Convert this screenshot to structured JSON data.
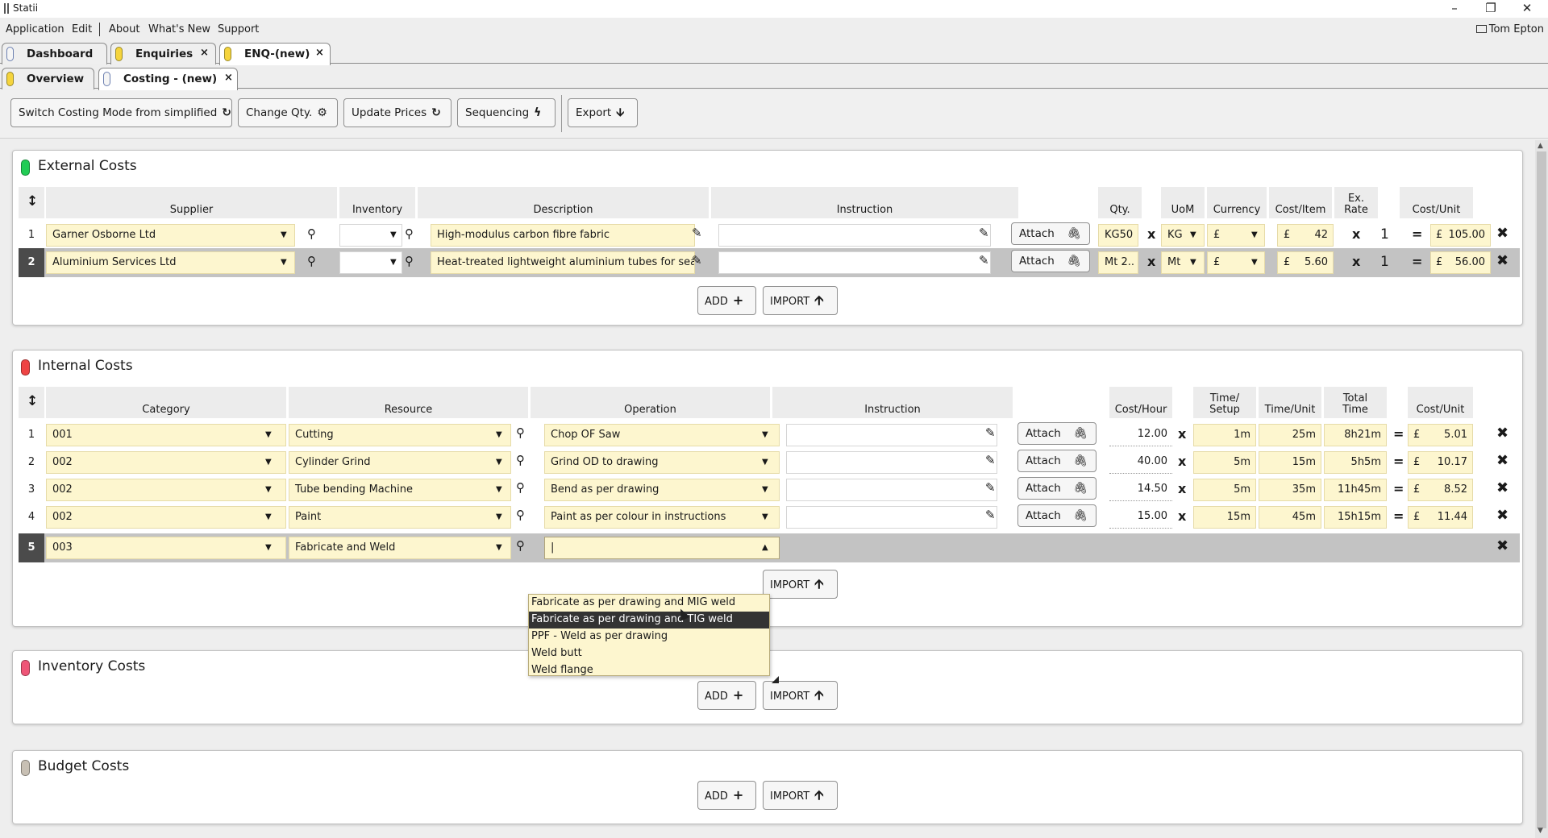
{
  "window": {
    "title": "Statii",
    "minimize": "–",
    "restore": "❐",
    "close": "✕"
  },
  "menu": {
    "items": [
      "Application",
      "Edit",
      "About",
      "What's New",
      "Support"
    ],
    "user": "Tom Epton"
  },
  "tabs_top": [
    {
      "label": "Dashboard"
    },
    {
      "label": "Enquiries",
      "close": "×"
    },
    {
      "label": "ENQ-(new)",
      "close": "×"
    }
  ],
  "tabs_sub": [
    {
      "label": "Overview"
    },
    {
      "label": "Costing - (new)",
      "close": "×"
    }
  ],
  "toolbar": {
    "switch_mode": "Switch Costing Mode from simplified",
    "change_qty": "Change Qty.",
    "update_prices": "Update Prices",
    "sequencing": "Sequencing",
    "export": "Export"
  },
  "icons": {
    "refresh": "↻",
    "gear": "⚙",
    "bolt": "ϟ",
    "down": "🡫",
    "up": "🡩",
    "plus": "+",
    "search": "⚲",
    "pencil": "✎",
    "paperclip": "🖇",
    "caret_down": "▼",
    "caret_up": "▲",
    "delete": "✖",
    "sort": "↕"
  },
  "colors": {
    "external": "#22cc55",
    "internal": "#ee4444",
    "inventory": "#ee5577",
    "budget": "#c8c0b4",
    "field_yellow": "#fdf6cf",
    "selected_row": "#333333"
  },
  "external": {
    "title": "External Costs",
    "headers": {
      "supplier": "Supplier",
      "inventory": "Inventory",
      "description": "Description",
      "instruction": "Instruction",
      "qty": "Qty.",
      "uom": "UoM",
      "currency": "Currency",
      "cost_item": "Cost/Item",
      "ex_rate_1": "Ex.",
      "ex_rate_2": "Rate",
      "cost_unit": "Cost/Unit"
    },
    "rows": [
      {
        "num": "1",
        "supplier": "Garner Osborne Ltd",
        "inventory": "",
        "description": "High-modulus carbon fibre fabric",
        "instruction": "",
        "attach": "Attach",
        "qty": "KG50",
        "x": "x",
        "uom": "KG",
        "currency": "£",
        "cost_currency": "£",
        "cost_item": "42",
        "ex_rate": "1",
        "eq": "=",
        "unit_currency": "£",
        "cost_unit": "105.00"
      },
      {
        "num": "2",
        "supplier": "Aluminium Services Ltd",
        "inventory": "",
        "description": "Heat-treated lightweight aluminium tubes for sea",
        "instruction": "",
        "attach": "Attach",
        "qty": "Mt 2..",
        "x": "x",
        "uom": "Mt",
        "currency": "£",
        "cost_currency": "£",
        "cost_item": "5.60",
        "ex_rate": "1",
        "eq": "=",
        "unit_currency": "£",
        "cost_unit": "56.00"
      }
    ],
    "add": "ADD",
    "import": "IMPORT"
  },
  "internal": {
    "title": "Internal Costs",
    "headers": {
      "category": "Category",
      "resource": "Resource",
      "operation": "Operation",
      "instruction": "Instruction",
      "cost_hour": "Cost/Hour",
      "time_setup_1": "Time/",
      "time_setup_2": "Setup",
      "time_unit": "Time/Unit",
      "total_time_1": "Total",
      "total_time_2": "Time",
      "cost_unit": "Cost/Unit"
    },
    "rows": [
      {
        "num": "1",
        "category": "001",
        "resource": "Cutting",
        "operation": "Chop OF Saw",
        "attach": "Attach",
        "cost_hour": "12.00",
        "x": "x",
        "setup": "1m",
        "time_unit": "25m",
        "total": "8h21m",
        "eq": "=",
        "currency": "£",
        "cost_unit": "5.01"
      },
      {
        "num": "2",
        "category": "002",
        "resource": "Cylinder Grind",
        "operation": "Grind OD to drawing",
        "attach": "Attach",
        "cost_hour": "40.00",
        "x": "x",
        "setup": "5m",
        "time_unit": "15m",
        "total": "5h5m",
        "eq": "=",
        "currency": "£",
        "cost_unit": "10.17"
      },
      {
        "num": "3",
        "category": "002",
        "resource": "Tube bending Machine",
        "operation": "Bend as per drawing",
        "attach": "Attach",
        "cost_hour": "14.50",
        "x": "x",
        "setup": "5m",
        "time_unit": "35m",
        "total": "11h45m",
        "eq": "=",
        "currency": "£",
        "cost_unit": "8.52"
      },
      {
        "num": "4",
        "category": "002",
        "resource": "Paint",
        "operation": "Paint as per colour in instructions",
        "attach": "Attach",
        "cost_hour": "15.00",
        "x": "x",
        "setup": "15m",
        "time_unit": "45m",
        "total": "15h15m",
        "eq": "=",
        "currency": "£",
        "cost_unit": "11.44"
      }
    ],
    "editing_row": {
      "num": "5",
      "category": "003",
      "resource": "Fabricate and Weld",
      "operation": ""
    },
    "dropdown_options": [
      "Fabricate as per drawing and MIG weld",
      "Fabricate as per drawing and TIG weld",
      "PPF - Weld as per drawing",
      "Weld butt",
      "Weld flange"
    ],
    "import": "IMPORT"
  },
  "inventory": {
    "title": "Inventory Costs",
    "add": "ADD",
    "import": "IMPORT"
  },
  "budget": {
    "title": "Budget Costs",
    "add": "ADD",
    "import": "IMPORT"
  }
}
